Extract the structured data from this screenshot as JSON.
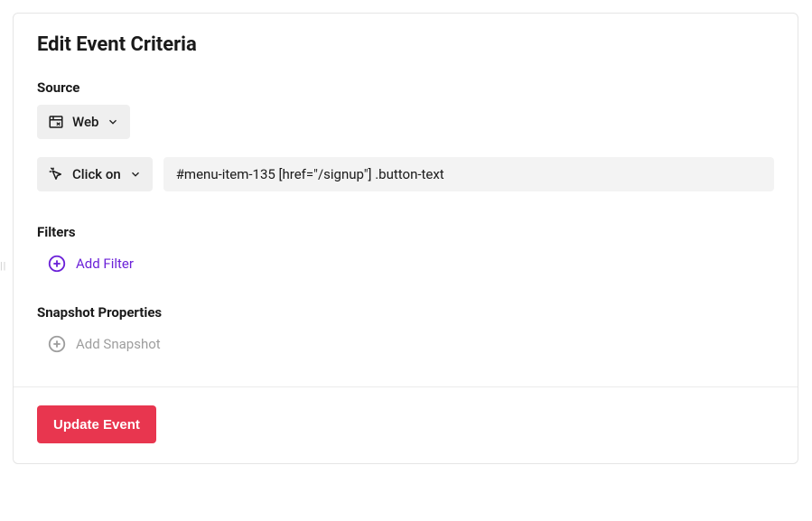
{
  "title": "Edit Event Criteria",
  "source": {
    "label": "Source",
    "selected": "Web"
  },
  "action": {
    "selected": "Click on",
    "selector_value": "#menu-item-135 [href=\"/signup\"] .button-text"
  },
  "filters": {
    "label": "Filters",
    "add_label": "Add Filter"
  },
  "snapshot": {
    "label": "Snapshot Properties",
    "add_label": "Add Snapshot"
  },
  "footer": {
    "update_label": "Update Event"
  },
  "colors": {
    "accent_purple": "#6b21d8",
    "primary_red": "#e8364f"
  }
}
